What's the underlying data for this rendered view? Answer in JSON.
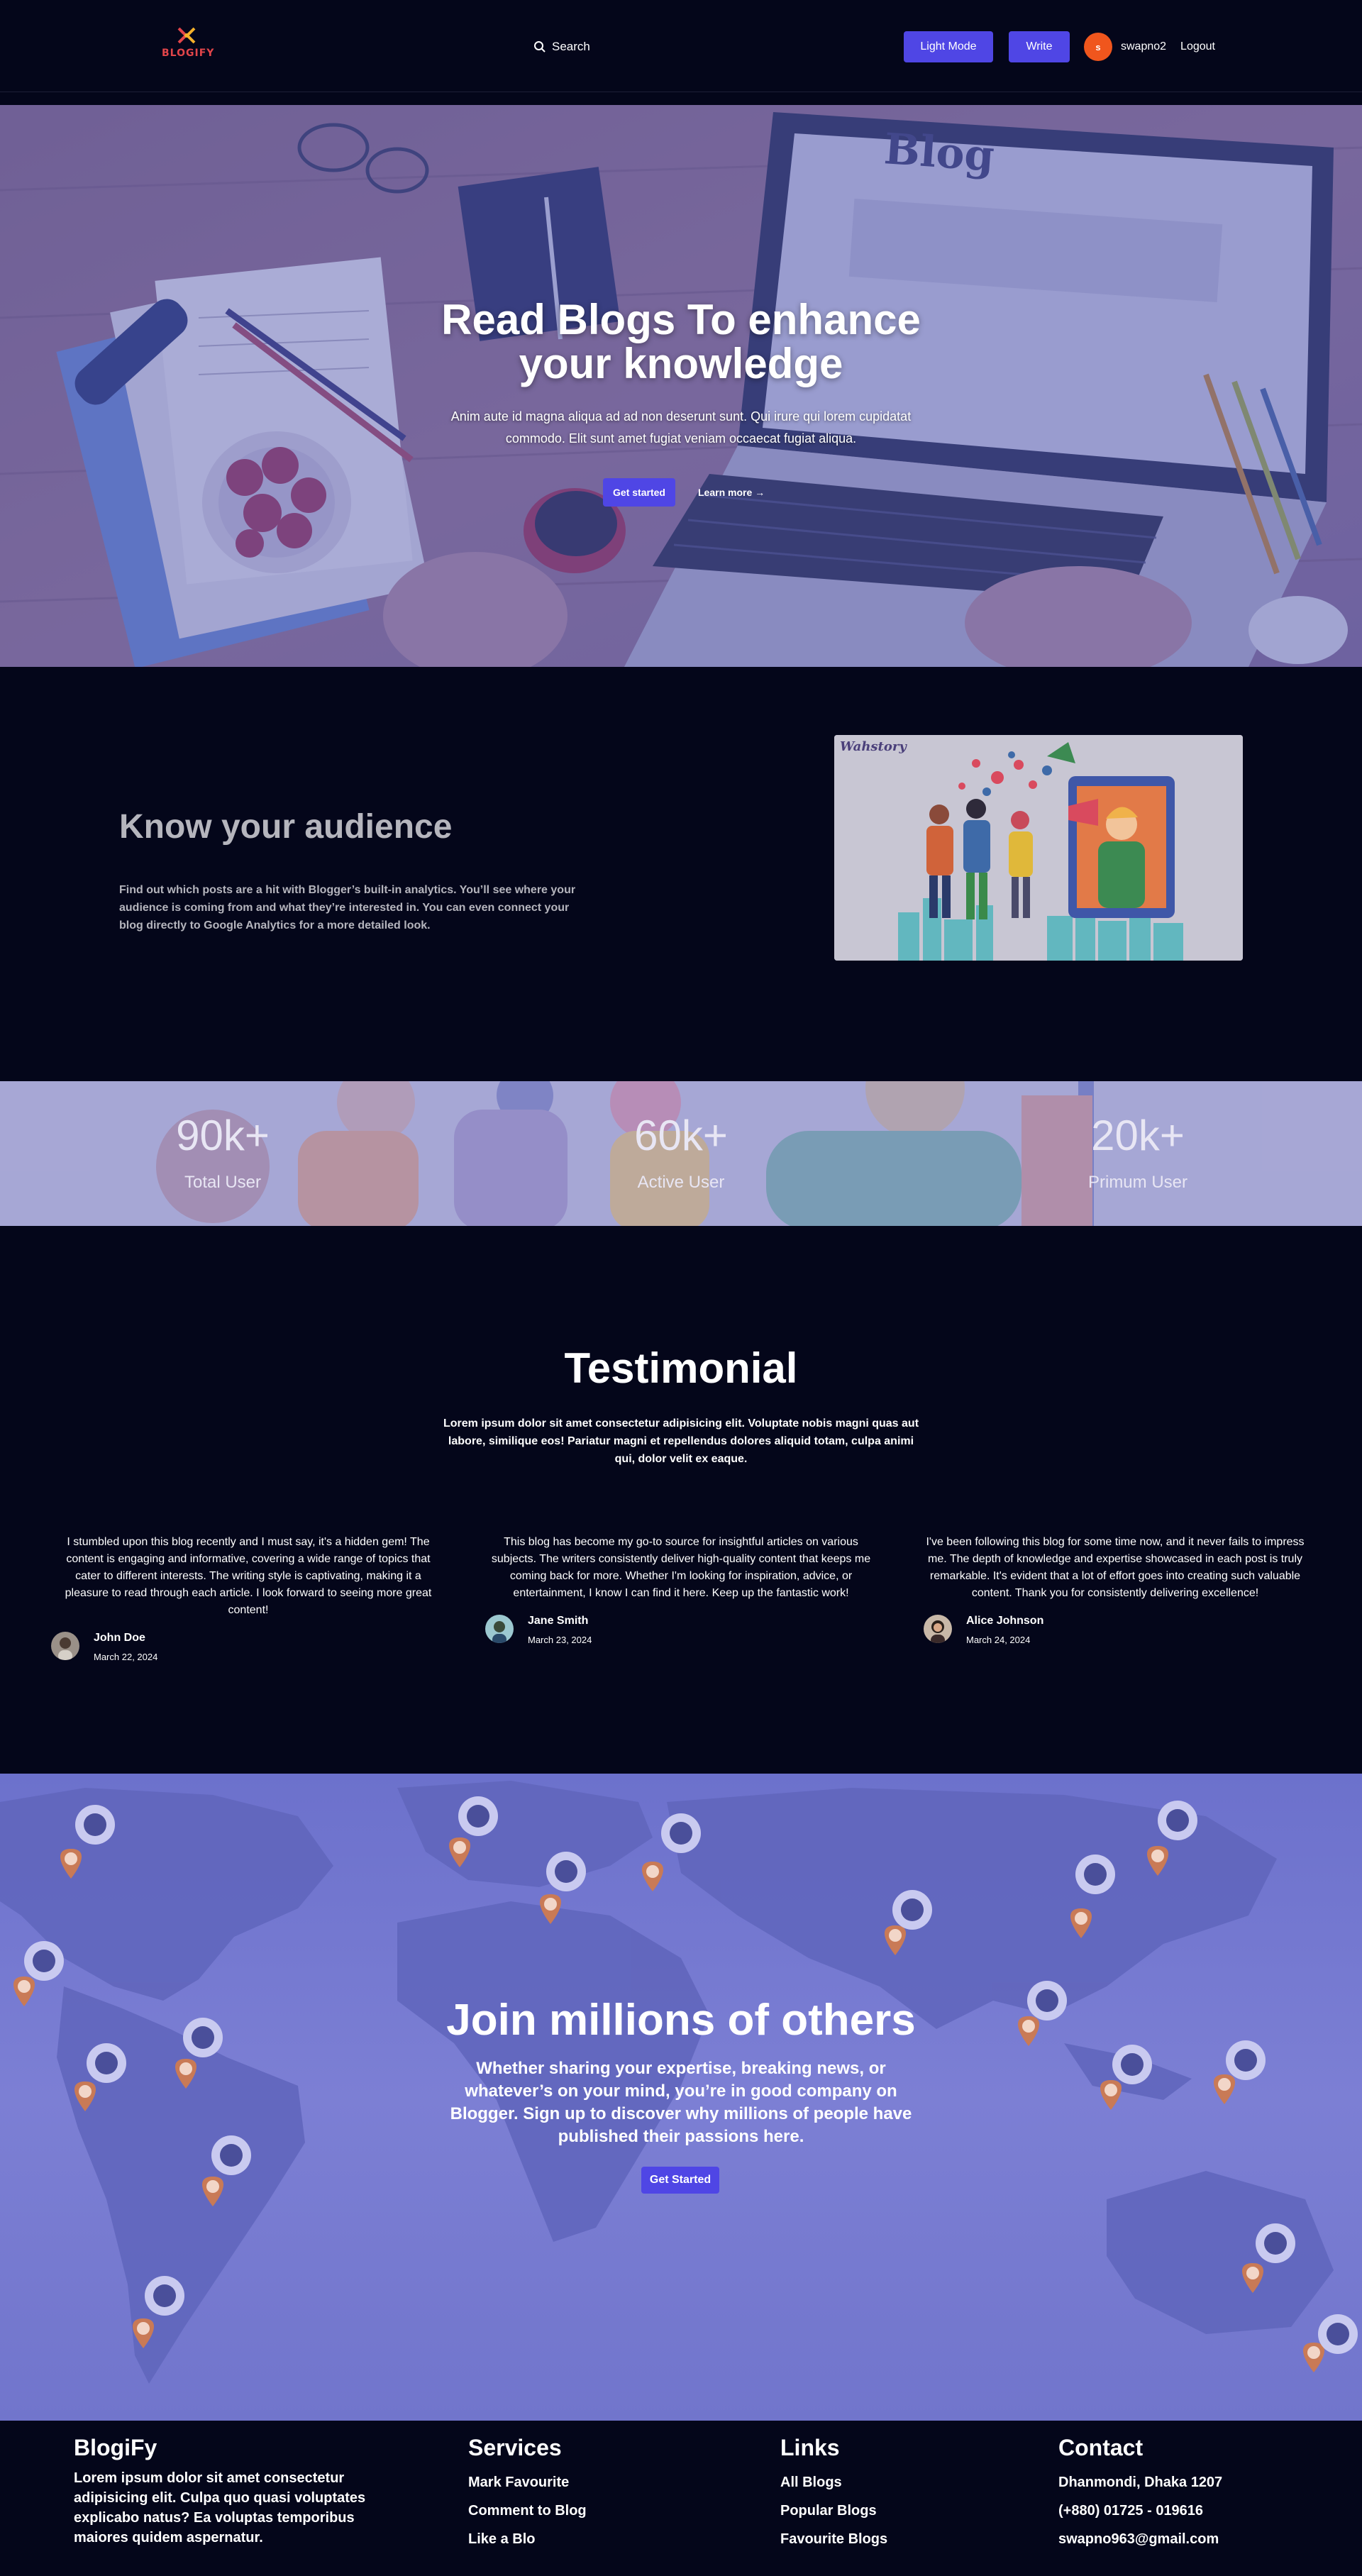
{
  "brand": {
    "logo_text": "BLOGIFY"
  },
  "nav": {
    "search_label": "Search",
    "light_mode_label": "Light Mode",
    "write_label": "Write",
    "avatar_initial": "s",
    "username": "swapno2",
    "logout_label": "Logout"
  },
  "hero": {
    "title": "Read Blogs To enhance your knowledge",
    "subtitle": "Anim aute id magna aliqua ad ad non deserunt sunt. Qui irure qui lorem cupidatat commodo. Elit sunt amet fugiat veniam occaecat fugiat aliqua.",
    "primary_cta": "Get started",
    "secondary_cta": "Learn more →",
    "laptop_screen_text": "Blog"
  },
  "audience": {
    "title": "Know your audience",
    "text": "Find out which posts are a hit with Blogger’s built-in analytics. You’ll see where your audience is coming from and what they’re interested in. You can even connect your blog directly to Google Analytics for a more detailed look.",
    "image_brand": "Wahstory"
  },
  "stats": [
    {
      "value": "90k+",
      "label": "Total User"
    },
    {
      "value": "60k+",
      "label": "Active User"
    },
    {
      "value": "20k+",
      "label": "Primum User"
    }
  ],
  "testimonial": {
    "title": "Testimonial",
    "subtitle": "Lorem ipsum dolor sit amet consectetur adipisicing elit. Voluptate nobis magni quas aut labore, similique eos! Pariatur magni et repellendus dolores aliquid totam, culpa animi qui, dolor velit ex eaque.",
    "items": [
      {
        "text": "I stumbled upon this blog recently and I must say, it's a hidden gem! The content is engaging and informative, covering a wide range of topics that cater to different interests. The writing style is captivating, making it a pleasure to read through each article. I look forward to seeing more great content!",
        "name": "John Doe",
        "date": "March 22, 2024"
      },
      {
        "text": "This blog has become my go-to source for insightful articles on various subjects. The writers consistently deliver high-quality content that keeps me coming back for more. Whether I'm looking for inspiration, advice, or entertainment, I know I can find it here. Keep up the fantastic work!",
        "name": "Jane Smith",
        "date": "March 23, 2024"
      },
      {
        "text": "I've been following this blog for some time now, and it never fails to impress me. The depth of knowledge and expertise showcased in each post is truly remarkable. It's evident that a lot of effort goes into creating such valuable content. Thank you for consistently delivering excellence!",
        "name": "Alice Johnson",
        "date": "March 24, 2024"
      }
    ]
  },
  "join": {
    "title": "Join millions of others",
    "text": "Whether sharing your expertise, breaking news, or whatever’s on your mind, you’re in good company on Blogger. Sign up to discover why millions of people have published their passions here.",
    "cta": "Get Started"
  },
  "footer": {
    "brand": {
      "title": "BlogiFy",
      "text": "Lorem ipsum dolor sit amet consectetur adipisicing elit. Culpa quo quasi voluptates explicabo natus? Ea voluptas temporibus maiores quidem aspernatur."
    },
    "services": {
      "title": "Services",
      "items": [
        "Mark Favourite",
        "Comment to Blog",
        "Like a Blo"
      ]
    },
    "links": {
      "title": "Links",
      "items": [
        "All Blogs",
        "Popular Blogs",
        "Favourite Blogs"
      ]
    },
    "contact": {
      "title": "Contact",
      "items": [
        "Dhanmondi, Dhaka 1207",
        "(+880) 01725 - 019616",
        "swapno963@gmail.com"
      ]
    }
  },
  "colors": {
    "accent": "#4f46e5",
    "background": "#04061a",
    "avatar": "#f0561d",
    "pin": "#c97a56"
  }
}
